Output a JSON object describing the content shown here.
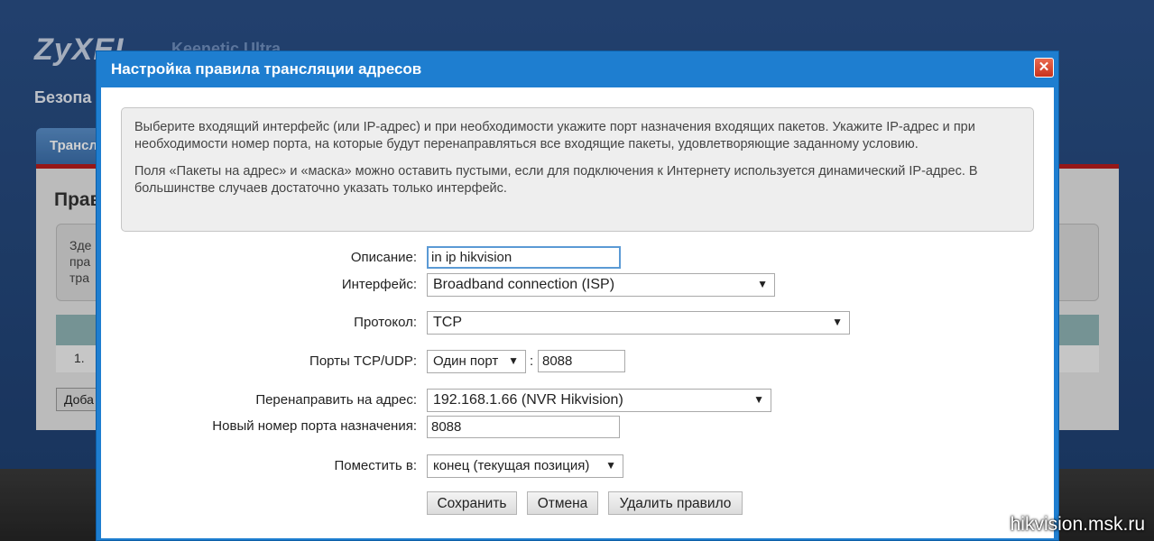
{
  "background": {
    "logo": "ZyXEL",
    "model": "Keenetic Ultra",
    "section": "Безопа",
    "tab": "Трансл",
    "panel_title": "Прав",
    "info_lines": [
      "Зде",
      "пра",
      "тра"
    ],
    "table_row": "1.",
    "add_button": "Доба"
  },
  "dialog": {
    "title": "Настройка правила трансляции адресов",
    "close_icon": "✕",
    "info": {
      "paragraph1": "Выберите входящий интерфейс (или IP-адрес) и при необходимости укажите порт назначения входящих пакетов. Укажите IP-адрес и при необходимости номер порта, на которые будут перенаправляться все входящие пакеты, удовлетворяющие заданному условию.",
      "paragraph2": "Поля «Пакеты на адрес» и «маска» можно оставить пустыми, если для подключения к Интернету используется динамический IP-адрес. В большинстве случаев достаточно указать только интерфейс."
    },
    "form": {
      "description_label": "Описание:",
      "description_value": "in ip hikvision",
      "interface_label": "Интерфейс:",
      "interface_value": "Broadband connection (ISP)",
      "protocol_label": "Протокол:",
      "protocol_value": "TCP",
      "ports_label": "Порты TCP/UDP:",
      "ports_mode_value": "Один порт",
      "ports_separator": ":",
      "port_value": "8088",
      "redirect_label": "Перенаправить на адрес:",
      "redirect_value": "192.168.1.66 (NVR Hikvision)",
      "new_port_label": "Новый номер порта назначения:",
      "new_port_value": "8088",
      "place_label": "Поместить в:",
      "place_value": "конец (текущая позиция)"
    },
    "buttons": {
      "save": "Сохранить",
      "cancel": "Отмена",
      "delete": "Удалить правило"
    }
  },
  "watermark": "hikvision.msk.ru",
  "colors": {
    "titlebar": "#1e7ed0",
    "close": "#c8321c",
    "focus": "#5b9ad5"
  }
}
